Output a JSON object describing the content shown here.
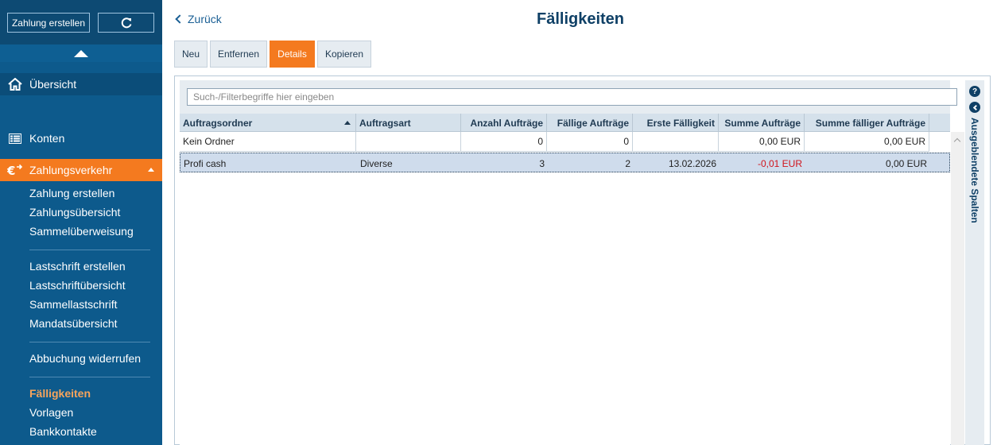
{
  "sidebar": {
    "create_button": "Zahlung erstellen",
    "refresh_icon": "refresh-icon",
    "main_items": {
      "overview": "Übersicht",
      "accounts": "Konten",
      "payments": "Zahlungsverkehr"
    },
    "sub_items": [
      "Zahlung erstellen",
      "Zahlungsübersicht",
      "Sammelüberweisung",
      "Lastschrift erstellen",
      "Lastschriftübersicht",
      "Sammellastschrift",
      "Mandatsübersicht",
      "Abbuchung widerrufen",
      "Fälligkeiten",
      "Vorlagen",
      "Bankkontakte"
    ],
    "active_sub": "Fälligkeiten"
  },
  "header": {
    "back": "Zurück",
    "title": "Fälligkeiten"
  },
  "toolbar": {
    "new": "Neu",
    "remove": "Entfernen",
    "details": "Details",
    "copy": "Kopieren"
  },
  "search": {
    "placeholder": "Such-/Filterbegriffe hier eingeben",
    "value": ""
  },
  "table": {
    "columns": [
      "Auftragsordner",
      "Auftragsart",
      "Anzahl Aufträge",
      "Fällige Aufträge",
      "Erste Fälligkeit",
      "Summe Aufträge",
      "Summe fälliger Aufträge"
    ],
    "sorted_column": "Auftragsordner",
    "sort_direction": "ascending",
    "rows": [
      [
        "Kein Ordner",
        "",
        "0",
        "0",
        "",
        "0,00 EUR",
        "0,00 EUR"
      ],
      [
        "Profi cash",
        "Diverse",
        "3",
        "2",
        "13.02.2026",
        "-0,01 EUR",
        "0,00 EUR"
      ]
    ],
    "selected_row": 1
  },
  "side_panel": {
    "help_symbol": "?",
    "hidden_columns_label": "Ausgeblendete Spalten"
  },
  "colors": {
    "sidebar": "#0d5a8c",
    "accent": "#f47a1f",
    "title": "#0f4066",
    "negative": "#d0141c"
  }
}
